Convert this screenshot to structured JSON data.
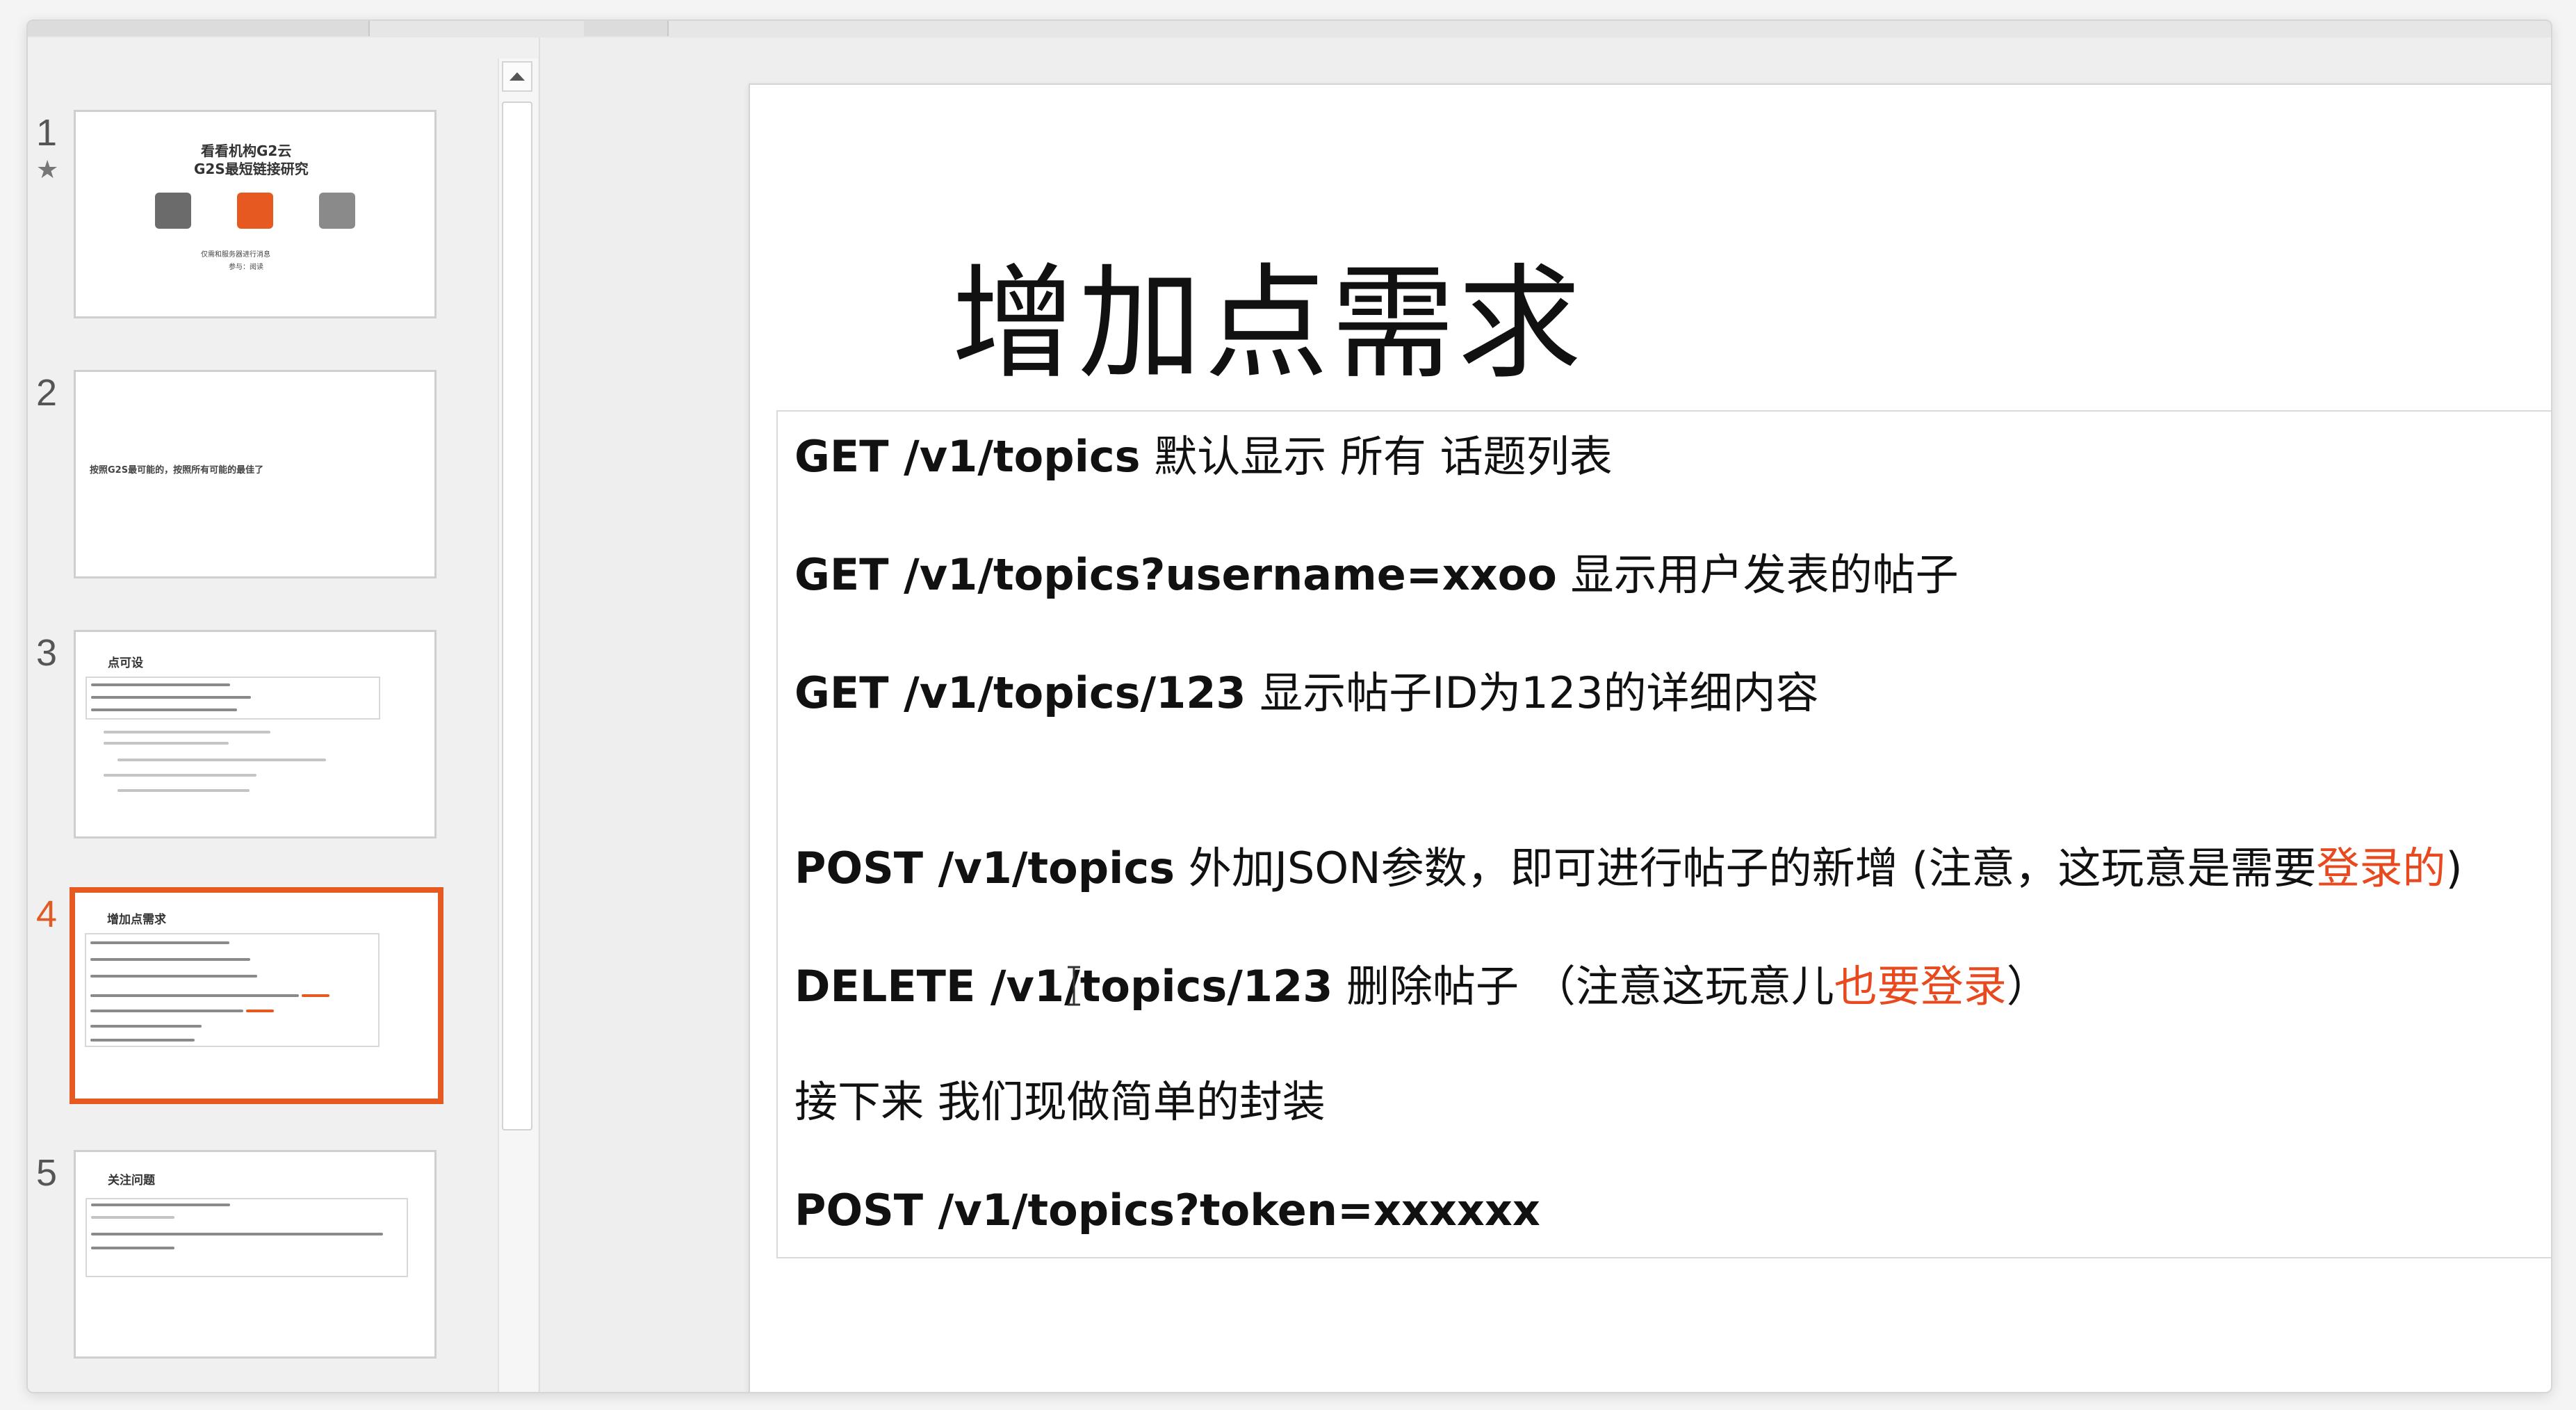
{
  "thumbnails": [
    {
      "number": "1",
      "star": "★",
      "title_lines": [
        "看看机构G2云",
        "G2S最短链接研究"
      ],
      "subtitle_lines": [
        "仅需和服务器进行消息",
        "参与：阅读"
      ]
    },
    {
      "number": "2",
      "text": "按照G2S最可能的，按照所有可能的最佳了"
    },
    {
      "number": "3",
      "title": "点可设"
    },
    {
      "number": "4",
      "title": "增加点需求"
    },
    {
      "number": "5",
      "title": "关注问题"
    }
  ],
  "slide": {
    "title": "增加点需求",
    "lines": [
      {
        "api": "GET /v1/topics",
        "text": " 默认显示 所有 话题列表"
      },
      {
        "api": "GET /v1/topics?username=xxoo",
        "text": " 显示用户发表的帖子"
      },
      {
        "api": "GET /v1/topics/123",
        "text": " 显示帖子ID为123的详细内容"
      },
      {
        "api": "POST /v1/topics",
        "text": " 外加JSON参数，即可进行帖子的新增 (注意，这玩意是需要",
        "red": "登录的",
        "tail": ")"
      },
      {
        "api": "DELETE /v1/topics/123",
        "text": " 删除帖子 （注意这玩意儿",
        "red": "也要登录",
        "tail": "）"
      },
      {
        "text": "接下来 我们现做简单的封装"
      },
      {
        "api": "POST /v1/topics?token=xxxxxx"
      }
    ]
  },
  "colors": {
    "accent": "#e65a22",
    "red_text": "#e8491e"
  }
}
